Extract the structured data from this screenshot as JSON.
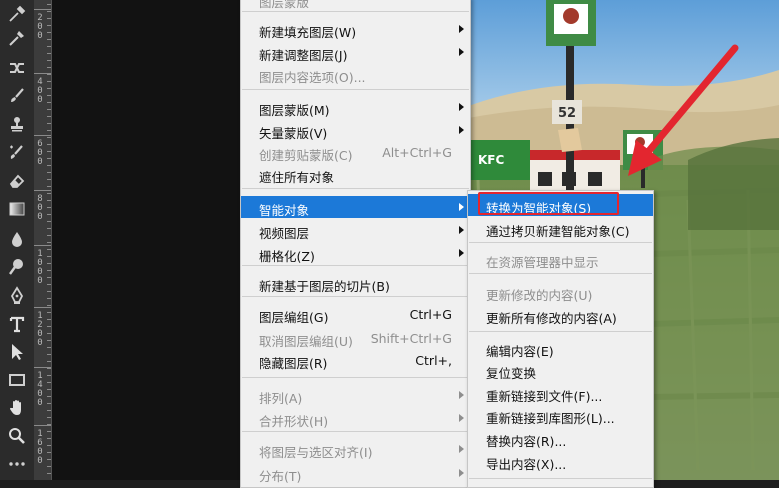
{
  "tools": [
    {
      "name": "eyedropper-tool-icon"
    },
    {
      "name": "patch-tool-icon"
    },
    {
      "name": "brush-tool-icon"
    },
    {
      "name": "stamp-tool-icon"
    },
    {
      "name": "history-brush-tool-icon"
    },
    {
      "name": "eraser-tool-icon"
    },
    {
      "name": "gradient-tool-icon"
    },
    {
      "name": "blur-tool-icon"
    },
    {
      "name": "dodge-tool-icon"
    },
    {
      "name": "pen-tool-icon"
    },
    {
      "name": "type-tool-icon"
    },
    {
      "name": "path-selection-tool-icon"
    },
    {
      "name": "rectangle-tool-icon"
    },
    {
      "name": "hand-tool-icon"
    },
    {
      "name": "zoom-tool-icon"
    },
    {
      "name": "more-tools-icon"
    }
  ],
  "ruler": {
    "labels": [
      "200",
      "400",
      "600",
      "800",
      "1000",
      "1200",
      "1400",
      "1600"
    ]
  },
  "photo": {
    "sign_number": "52",
    "kfc_text": "KFC"
  },
  "main_menu": {
    "items": [
      {
        "id": "cut",
        "label": "图层蒙版",
        "disabled": true
      },
      {
        "id": "new-fill-layer",
        "label": "新建填充图层(W)",
        "submenu": true
      },
      {
        "id": "new-adjustment-layer",
        "label": "新建调整图层(J)",
        "submenu": true
      },
      {
        "id": "layer-content-options",
        "label": "图层内容选项(O)...",
        "disabled": true
      },
      {
        "id": "layer-mask",
        "label": "图层蒙版(M)",
        "submenu": true
      },
      {
        "id": "vector-mask",
        "label": "矢量蒙版(V)",
        "submenu": true
      },
      {
        "id": "create-clipping-mask",
        "label": "创建剪贴蒙版(C)",
        "shortcut": "Alt+Ctrl+G",
        "disabled": true
      },
      {
        "id": "mask-all-objects",
        "label": "遮住所有对象"
      },
      {
        "id": "smart-objects",
        "label": "智能对象",
        "submenu": true,
        "active": true
      },
      {
        "id": "video-layers",
        "label": "视频图层",
        "submenu": true
      },
      {
        "id": "rasterize",
        "label": "栅格化(Z)",
        "submenu": true
      },
      {
        "id": "new-layer-based-slice",
        "label": "新建基于图层的切片(B)"
      },
      {
        "id": "group-layers",
        "label": "图层编组(G)",
        "shortcut": "Ctrl+G"
      },
      {
        "id": "ungroup-layers",
        "label": "取消图层编组(U)",
        "shortcut": "Shift+Ctrl+G",
        "disabled": true
      },
      {
        "id": "hide-layers",
        "label": "隐藏图层(R)",
        "shortcut": "Ctrl+,"
      },
      {
        "id": "arrange",
        "label": "排列(A)",
        "submenu": true,
        "disabled": true
      },
      {
        "id": "combine-shapes",
        "label": "合并形状(H)",
        "submenu": true,
        "disabled": true
      },
      {
        "id": "align-layers-to-selection",
        "label": "将图层与选区对齐(I)",
        "submenu": true,
        "disabled": true
      },
      {
        "id": "distribute",
        "label": "分布(T)",
        "submenu": true,
        "disabled": true
      }
    ]
  },
  "sub_menu": {
    "items": [
      {
        "id": "convert-to-smart-object",
        "label": "转换为智能对象(S)",
        "active": true
      },
      {
        "id": "new-smart-object-via-copy",
        "label": "通过拷贝新建智能对象(C)"
      },
      {
        "id": "reveal-in-explorer",
        "label": "在资源管理器中显示",
        "disabled": true
      },
      {
        "id": "update-modified-content",
        "label": "更新修改的内容(U)",
        "disabled": true
      },
      {
        "id": "update-all-modified-content",
        "label": "更新所有修改的内容(A)"
      },
      {
        "id": "edit-contents",
        "label": "编辑内容(E)"
      },
      {
        "id": "reset-transform",
        "label": "复位变换"
      },
      {
        "id": "relink-to-file",
        "label": "重新链接到文件(F)..."
      },
      {
        "id": "relink-to-library-graphic",
        "label": "重新链接到库图形(L)..."
      },
      {
        "id": "replace-contents",
        "label": "替换内容(R)..."
      },
      {
        "id": "export-contents",
        "label": "导出内容(X)..."
      }
    ]
  },
  "colors": {
    "menu_bg": "#f0f0f0",
    "highlight": "#1c79d8",
    "annotation_red": "#e3262f"
  }
}
